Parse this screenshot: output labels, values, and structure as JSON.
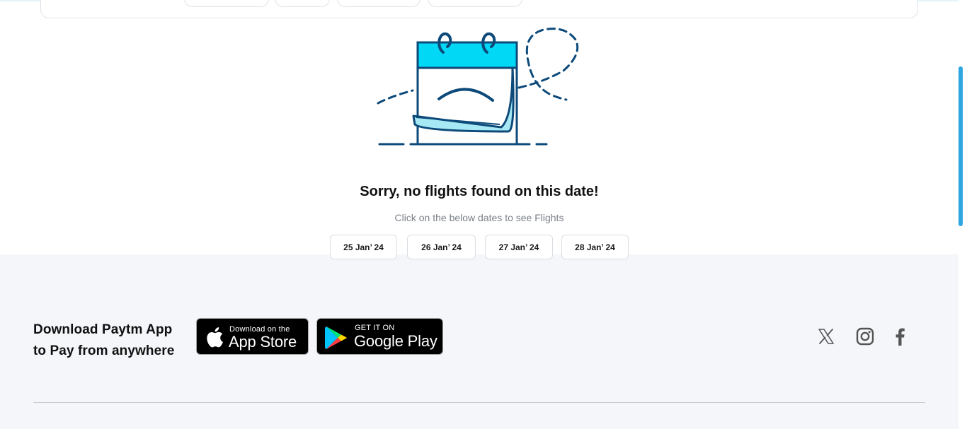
{
  "colors": {
    "accent_blue": "#2fa6e0",
    "calendar_cyan": "#00d8f6",
    "illustration_navy": "#0d4a7a",
    "footer_bg": "#f5f6f9"
  },
  "empty_state": {
    "title": "Sorry, no flights found on this date!",
    "subtitle": "Click on the below dates to see Flights",
    "illustration_icon": "sad-calendar-icon",
    "dates": [
      "25 Jan’ 24",
      "26 Jan’ 24",
      "27 Jan’ 24",
      "28 Jan’ 24"
    ]
  },
  "footer": {
    "download_line1": "Download Paytm App",
    "download_line2": "to Pay from anywhere",
    "app_store": {
      "small": "Download on the",
      "big": "App Store",
      "icon": "apple-icon"
    },
    "google_play": {
      "small": "GET IT ON",
      "big": "Google Play",
      "icon": "google-play-icon"
    },
    "social_icons": [
      "x-icon",
      "instagram-icon",
      "facebook-icon"
    ]
  }
}
